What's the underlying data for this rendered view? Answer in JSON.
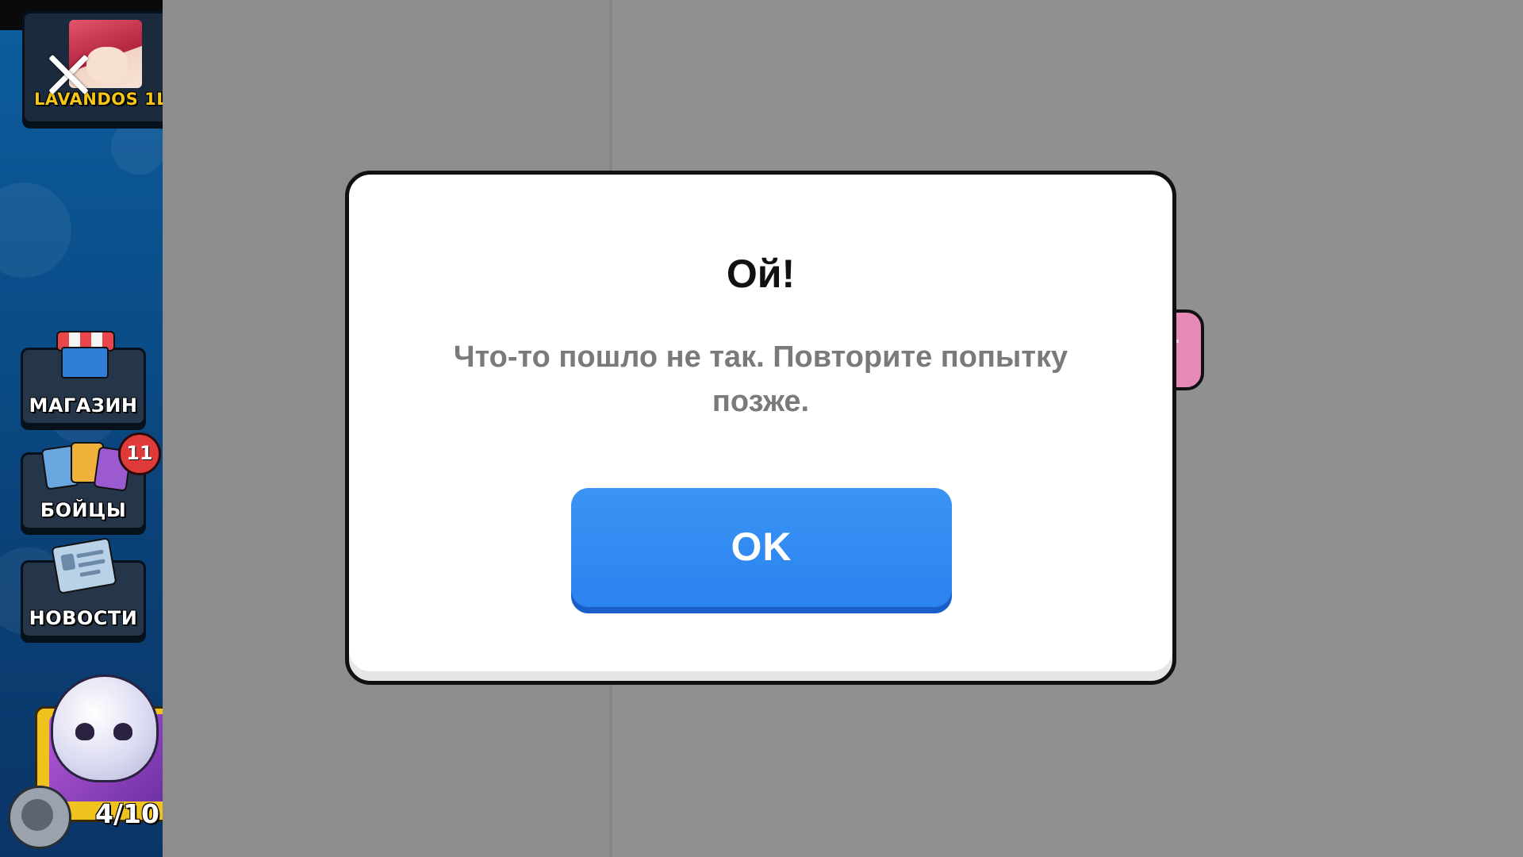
{
  "sidebar": {
    "profile_name": "LAVANDOS 1L",
    "close_icon": "close-icon",
    "items": [
      {
        "label": "МАГАЗИН",
        "icon": "shop-icon"
      },
      {
        "label": "БОЙЦЫ",
        "icon": "brawlers-icon",
        "badge": "11"
      },
      {
        "label": "НОВОСТИ",
        "icon": "news-icon"
      }
    ],
    "starr_drop_progress": "4/10"
  },
  "dialog": {
    "title": "Ой!",
    "message": "Что-то пошло не так. Повторите попытку позже.",
    "ok_label": "OK"
  },
  "colors": {
    "sidebar_blue": "#0a4e8a",
    "overlay_gray": "#8f8f8f",
    "ok_button_blue": "#2a82ef",
    "badge_red": "#e03a3a",
    "label_yellow": "#f5c518"
  }
}
